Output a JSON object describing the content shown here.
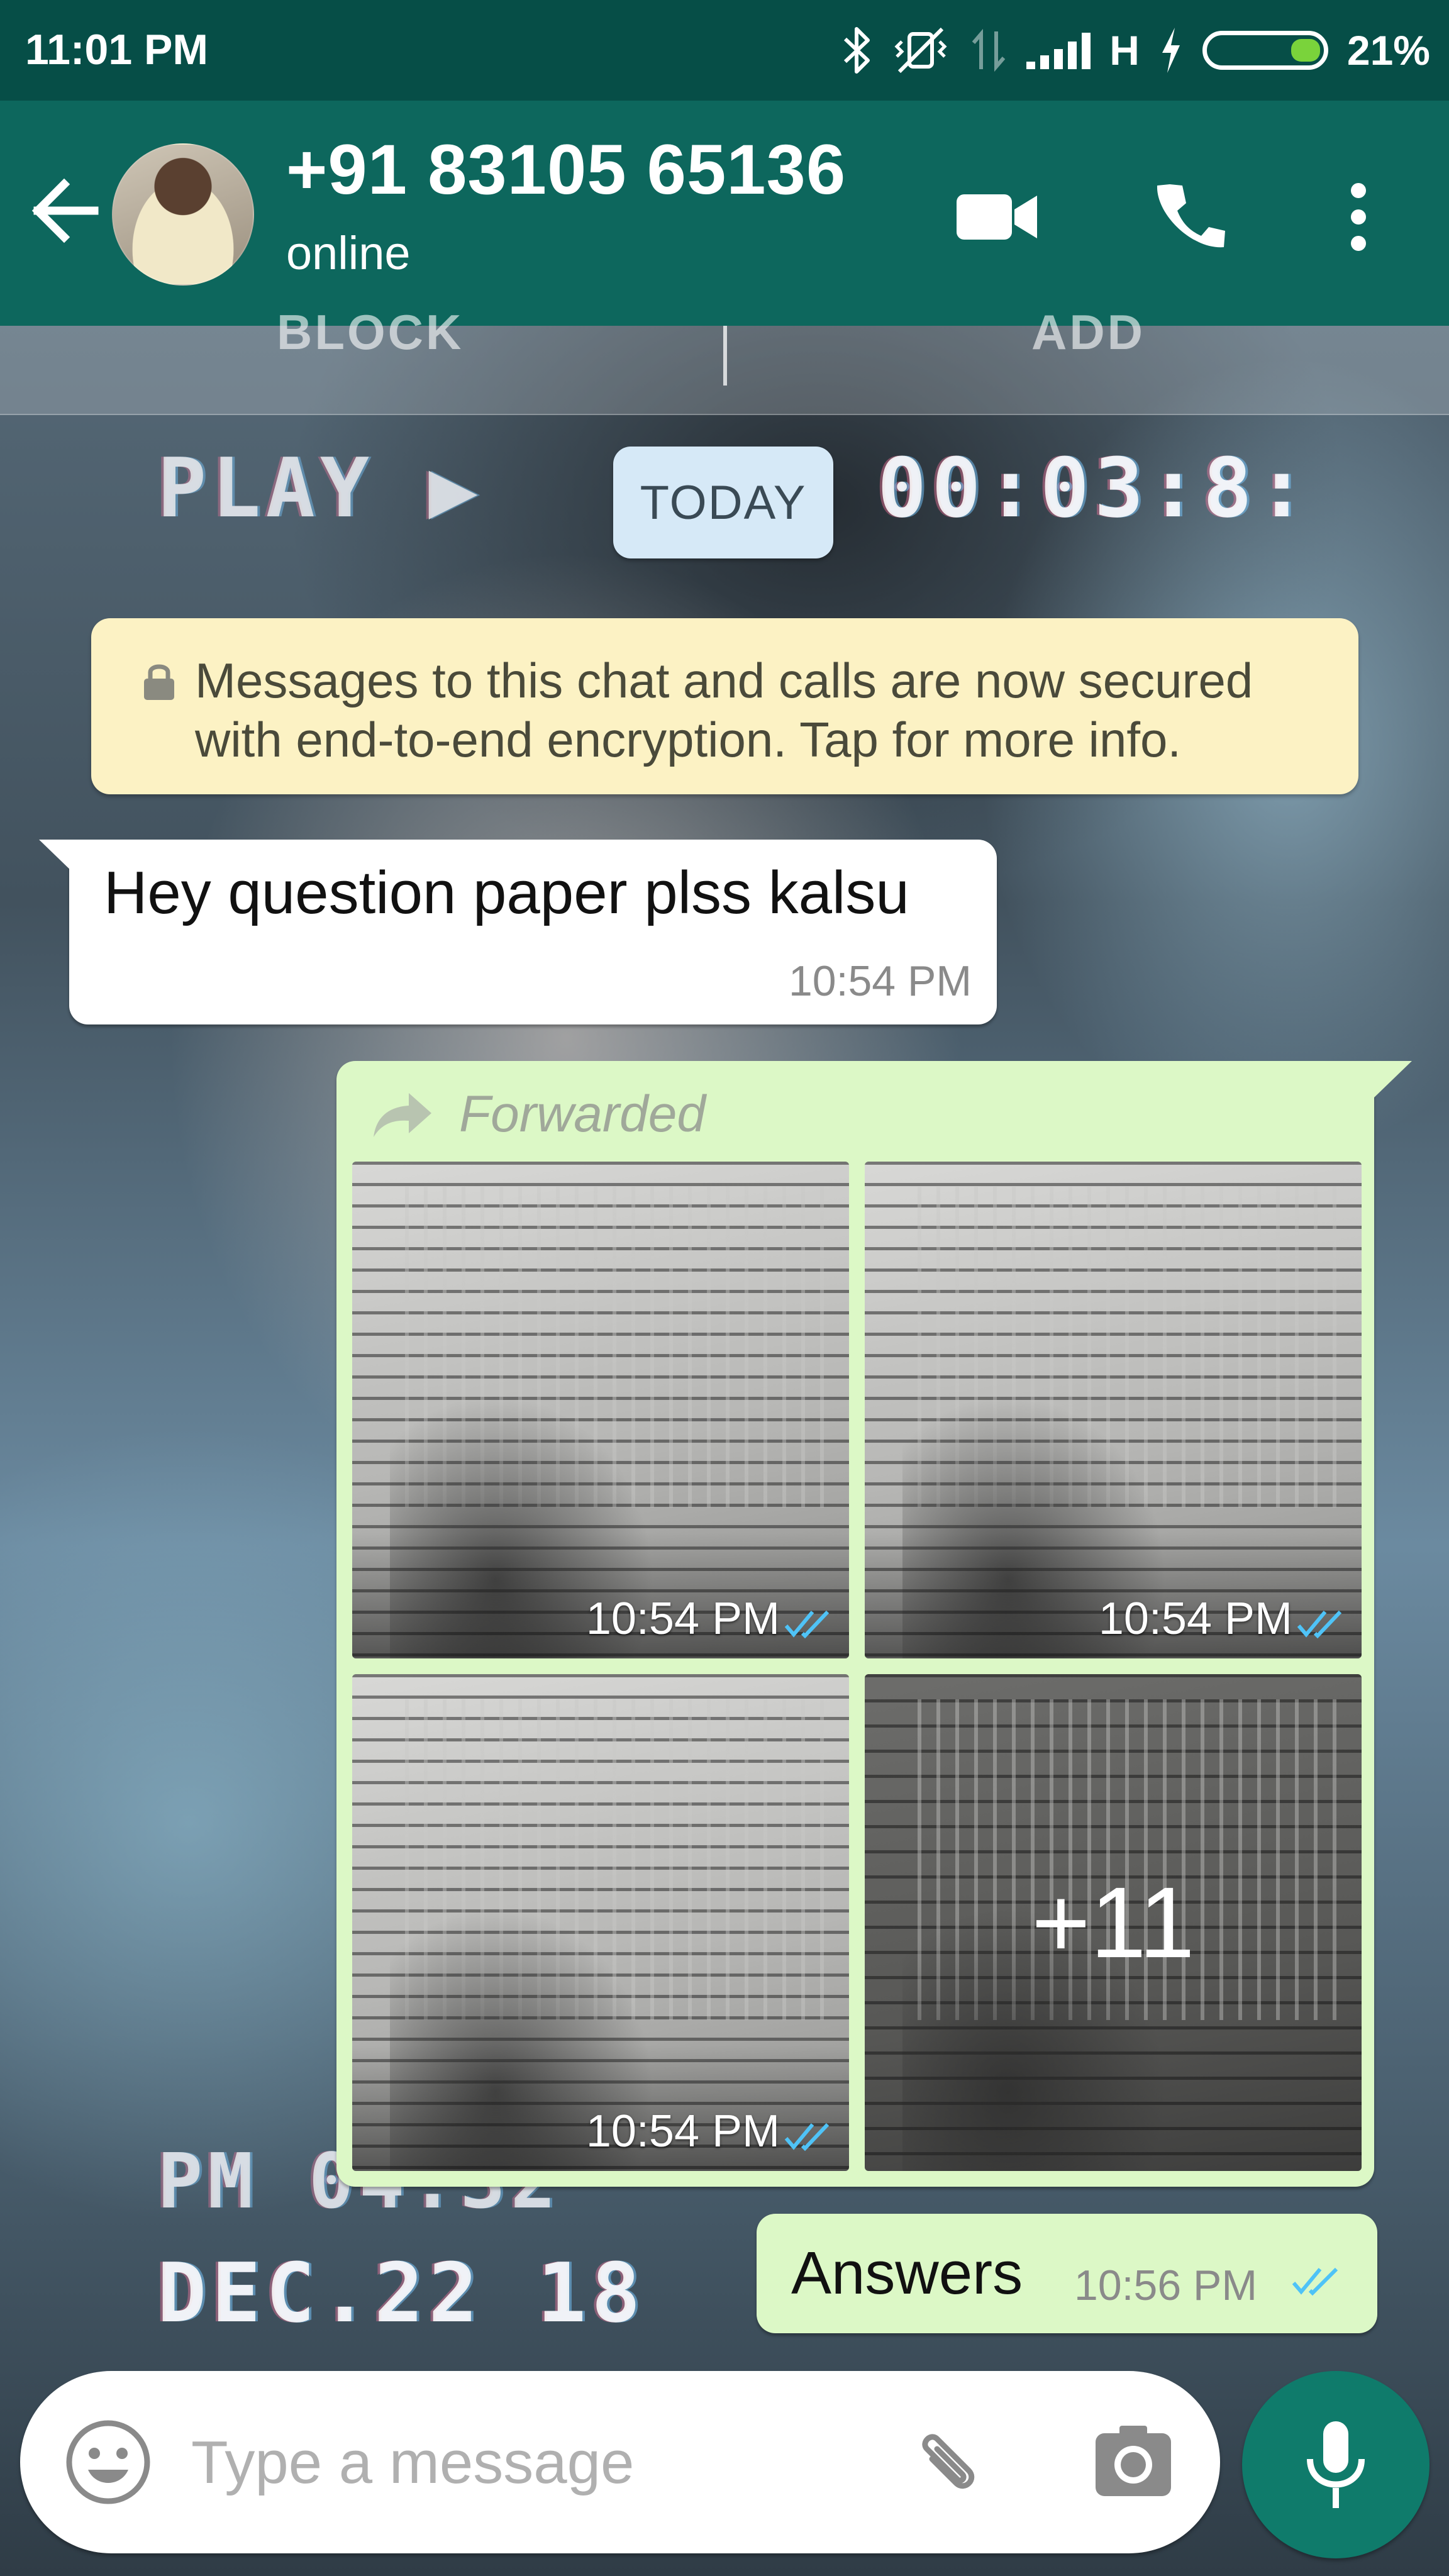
{
  "status_bar": {
    "time": "11:01 PM",
    "network_type": "H",
    "battery_percent": "21%",
    "battery_level": 0.21,
    "icons": [
      "bluetooth-icon",
      "vibrate-mute-icon",
      "data-arrows-icon",
      "signal-icon",
      "charging-icon",
      "battery-icon"
    ]
  },
  "header": {
    "contact_name": "+91 83105 65136",
    "contact_status": "online",
    "icons": [
      "back-arrow-icon",
      "video-call-icon",
      "voice-call-icon",
      "more-options-icon"
    ]
  },
  "wallpaper": {
    "overlay_play": "PLAY ▶",
    "overlay_timer": "00:03:8:",
    "overlay_pm": "PM 04:32",
    "overlay_date": "DEC.22 18"
  },
  "chat": {
    "date_chip": "TODAY",
    "encryption_notice": "Messages to this chat and calls are now secured with end-to-end encryption. Tap for more info.",
    "messages": [
      {
        "direction": "incoming",
        "text": "Hey question paper plss kalsu",
        "time": "10:54 PM"
      },
      {
        "direction": "outgoing",
        "forwarded_label": "Forwarded",
        "media": [
          {
            "time": "10:54 PM",
            "status": "read"
          },
          {
            "time": "10:54 PM",
            "status": "read"
          },
          {
            "time": "10:54 PM",
            "status": "read"
          },
          {
            "more_count": "+11"
          }
        ]
      },
      {
        "direction": "outgoing",
        "text": "Answers",
        "time": "10:56 PM",
        "status": "read"
      }
    ]
  },
  "composer": {
    "placeholder": "Type a message",
    "icons": [
      "emoji-icon",
      "attach-icon",
      "camera-icon",
      "mic-icon"
    ]
  },
  "colors": {
    "header": "#0d675d",
    "status_bar": "#064e47",
    "outgoing_bubble": "#dcf8c6",
    "incoming_bubble": "#ffffff",
    "read_ticks": "#4fc3f7",
    "mic_button": "#0f7b6b"
  }
}
